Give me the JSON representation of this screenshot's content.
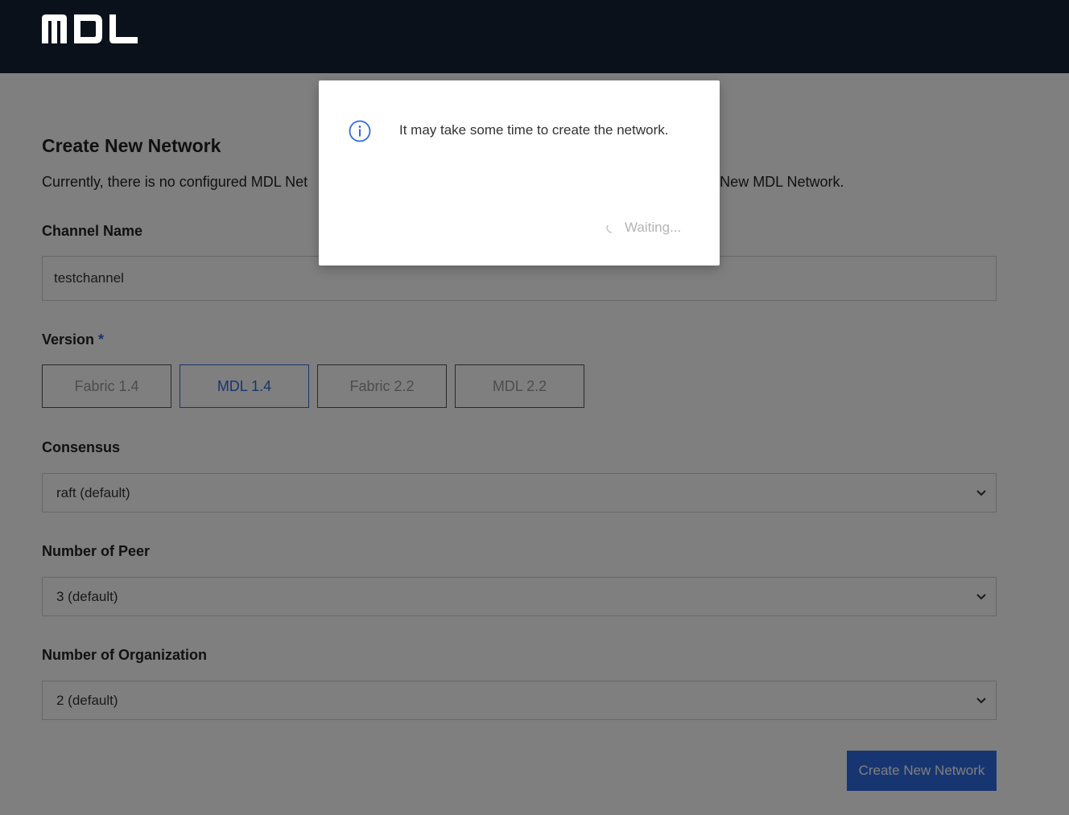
{
  "header": {
    "logo_text": "MDL"
  },
  "form": {
    "title": "Create New Network",
    "description_left": "Currently, there is no configured MDL Net",
    "description_right": "ate New MDL Network.",
    "channel": {
      "label": "Channel Name",
      "value": "testchannel"
    },
    "version": {
      "label": "Version",
      "required_mark": "*",
      "options": [
        "Fabric 1.4",
        "MDL 1.4",
        "Fabric 2.2",
        "MDL 2.2"
      ],
      "selected": "MDL 1.4"
    },
    "consensus": {
      "label": "Consensus",
      "value": "raft (default)"
    },
    "peers": {
      "label": "Number of Peer",
      "value": "3 (default)"
    },
    "orgs": {
      "label": "Number of Organization",
      "value": "2 (default)"
    },
    "submit_label": "Create New Network"
  },
  "modal": {
    "icon": "info-icon",
    "message": "It may take some time to create the network.",
    "status": "Waiting..."
  },
  "colors": {
    "accent": "#2f6be0",
    "header_bg": "#0b111b"
  }
}
